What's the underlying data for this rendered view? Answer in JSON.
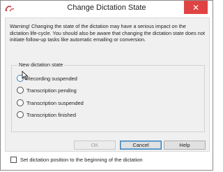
{
  "window": {
    "title": "Change Dictation State",
    "close_glyph": "✕",
    "app_icon": "dictation-app-icon"
  },
  "warning": {
    "text": "Warning! Changing the state of the dictation may have a serious impact on the dictation life-cycle. You should also be aware that changing the dictation state does not initiate follow-up tasks like automatic emailing or conversion."
  },
  "group": {
    "title": "New dictation state",
    "options": [
      {
        "label": "Recording suspended",
        "selected": false
      },
      {
        "label": "Transcription pending",
        "selected": false
      },
      {
        "label": "Transcription suspended",
        "selected": false
      },
      {
        "label": "Transcription finished",
        "selected": false
      }
    ]
  },
  "buttons": {
    "ok": "OK",
    "cancel": "Cancel",
    "help": "Help"
  },
  "footer": {
    "checkbox_label": "Set dictation position to the beginning of the dictation",
    "checked": false
  },
  "colors": {
    "close_button": "#e04343",
    "dialog_bg": "#f0f0f0",
    "focus_border": "#3c7fb1"
  }
}
